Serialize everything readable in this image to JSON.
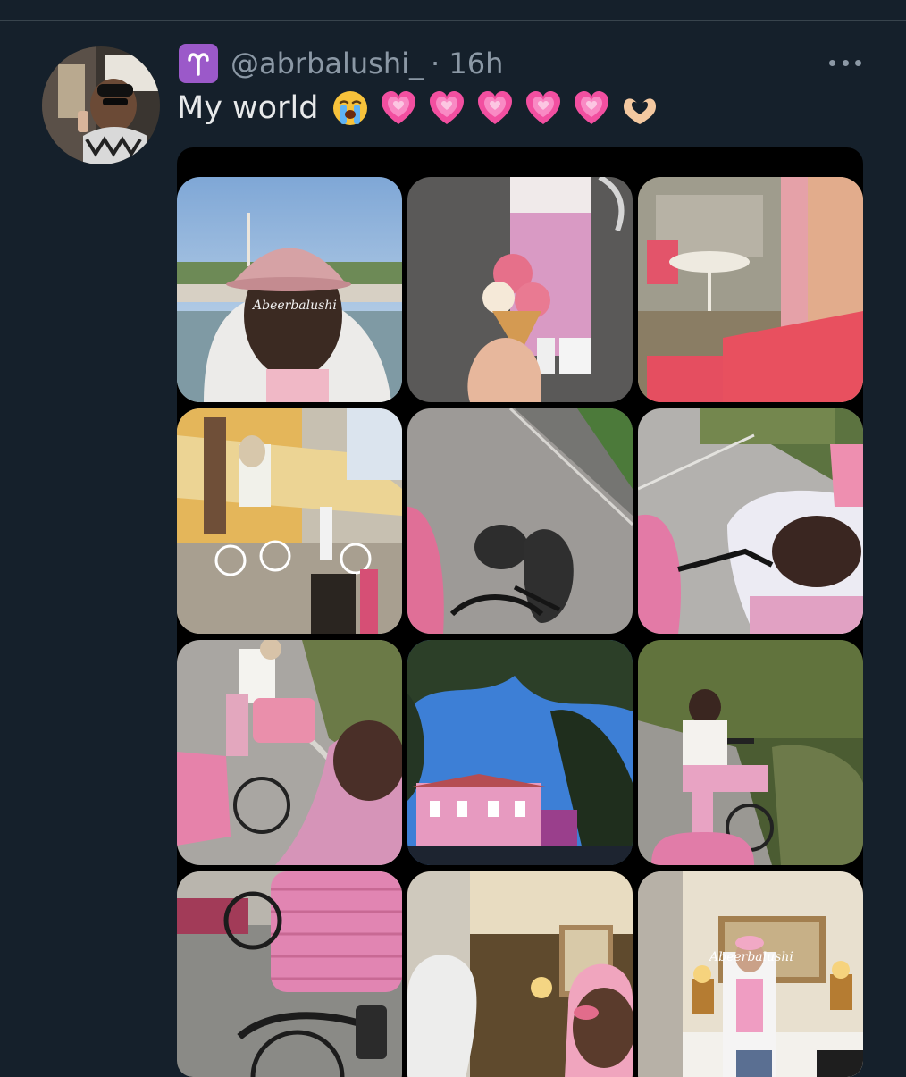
{
  "tweet": {
    "handle": "@abrbalushi_",
    "time": "· 16h",
    "text": "My world",
    "emojis": [
      "loudly-crying-face",
      "growing-heart",
      "growing-heart",
      "growing-heart",
      "growing-heart",
      "growing-heart",
      "heart-hands"
    ],
    "avatar_icon": "profile-avatar",
    "badge_icon": "aries-icon",
    "more_icon": "more-icon"
  },
  "media": {
    "watermark": "Abeerbalushi",
    "tiles": [
      {
        "name": "photo-pink-cap-waterfront"
      },
      {
        "name": "photo-ice-cream-cone"
      },
      {
        "name": "photo-pink-cafe-window"
      },
      {
        "name": "photo-cafe-terrace"
      },
      {
        "name": "photo-bike-shadow-road"
      },
      {
        "name": "photo-bike-road-selfie"
      },
      {
        "name": "photo-cycling-friend"
      },
      {
        "name": "photo-pink-house-sky"
      },
      {
        "name": "photo-girl-on-bike"
      },
      {
        "name": "photo-bike-basket"
      },
      {
        "name": "photo-hotel-room-cap"
      },
      {
        "name": "photo-hotel-room-mirror"
      }
    ]
  },
  "colors": {
    "background": "#15202b",
    "text": "#e7e9ea",
    "muted": "#8b98a5",
    "badge": "#9b59c9",
    "pink": "#e28bb4"
  }
}
